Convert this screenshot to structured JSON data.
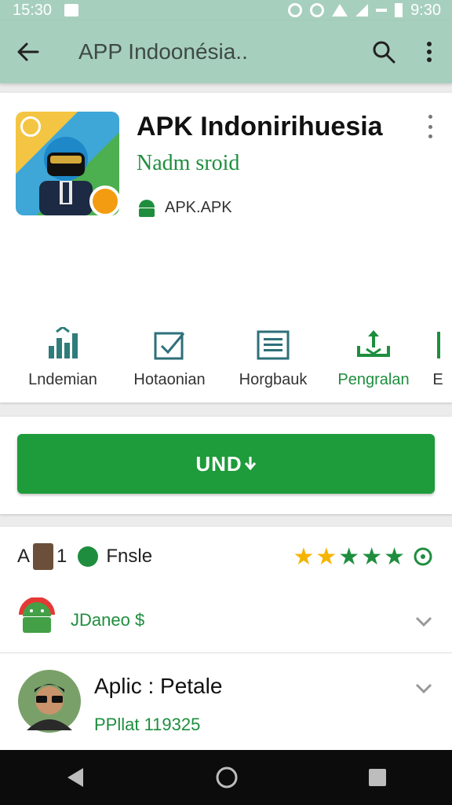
{
  "status_bar": {
    "time": "15:30",
    "right_time": "9:30"
  },
  "app_bar": {
    "title": "APP Indoonésia..",
    "back_icon": "arrow-left-icon",
    "search_icon": "search-icon",
    "more_icon": "more-vert-icon"
  },
  "app": {
    "title": "APK Indonirihuesia",
    "developer": "Nadm sroid",
    "meta_label": "APK.APK",
    "meta_icon": "android-icon"
  },
  "features": [
    {
      "label": "Lndemian",
      "icon": "chart-icon"
    },
    {
      "label": "Hotaonian",
      "icon": "checkbox-icon"
    },
    {
      "label": "Horgbauk",
      "icon": "document-icon"
    },
    {
      "label": "Pengralan",
      "icon": "download-icon"
    },
    {
      "label": "E",
      "icon": "bar-icon"
    }
  ],
  "install_button": {
    "label": "UND"
  },
  "rating": {
    "prefix": "A",
    "number": "1",
    "label": "Fnsle",
    "stars": 5,
    "star_colors": [
      "#f4b400",
      "#f4b400",
      "#1e8e3e",
      "#1e8e3e",
      "#1e8e3e"
    ]
  },
  "list": [
    {
      "text": "JDaneo $",
      "icon": "android-icon"
    },
    {
      "title": "Aplic : Petale",
      "subtitle": "PPllat 119325",
      "icon": "avatar"
    }
  ],
  "colors": {
    "accent": "#1e9b3a",
    "toolbar": "#a7cfbd",
    "text_green": "#1e8e3e"
  }
}
